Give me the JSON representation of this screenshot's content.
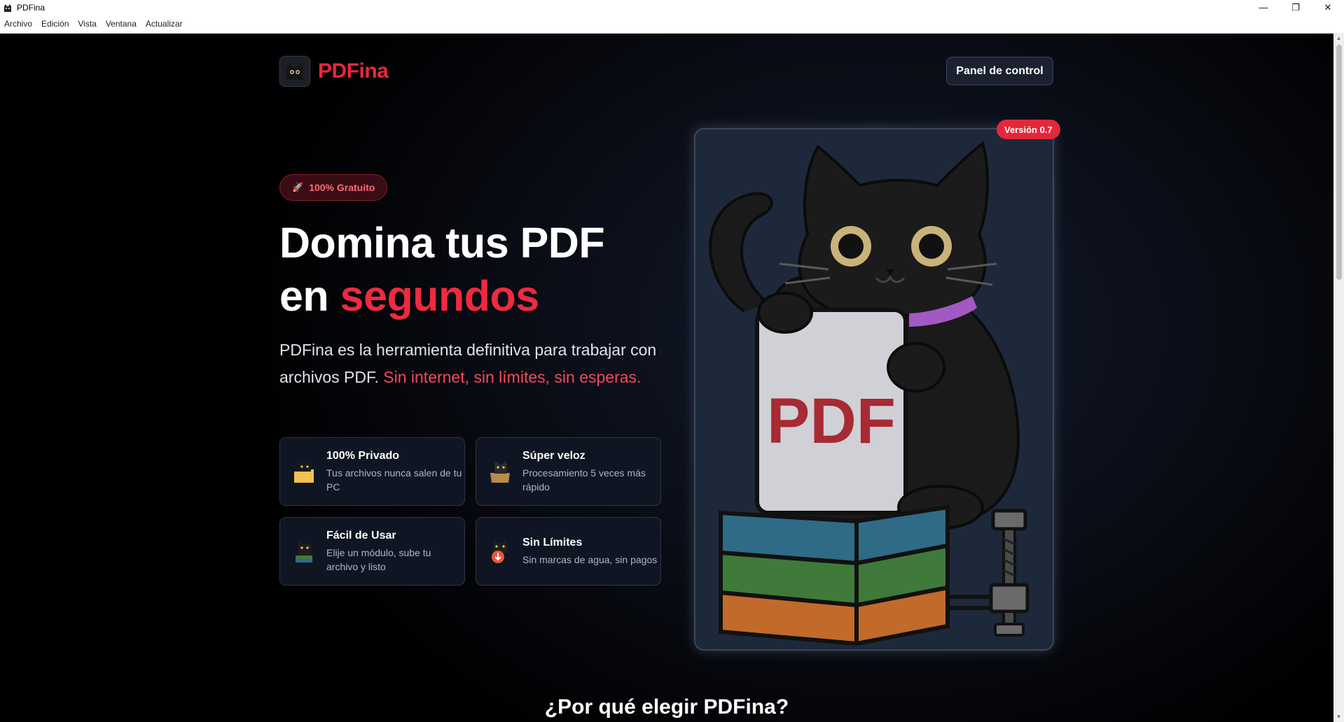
{
  "window": {
    "title": "PDFina",
    "controls": {
      "minimize": "—",
      "maximize": "❐",
      "close": "✕"
    }
  },
  "menu": [
    "Archivo",
    "Edición",
    "Vista",
    "Ventana",
    "Actualizar"
  ],
  "header": {
    "logo_text": "PDFina",
    "panel_button": "Panel de control"
  },
  "hero": {
    "badge": "100% Gratuito",
    "badge_icon": "rocket-icon",
    "title_line1": "Domina tus PDF",
    "title_line2_plain": "en ",
    "title_line2_accent": "segundos",
    "desc_plain": "PDFina es la herramienta definitiva para trabajar con archivos PDF. ",
    "desc_accent": "Sin internet, sin límites, sin esperas."
  },
  "features": [
    {
      "title": "100% Privado",
      "text": "Tus archivos nunca salen de tu PC",
      "icon": "cat-folder-icon"
    },
    {
      "title": "Súper veloz",
      "text": "Procesamiento 5 veces más rápido",
      "icon": "cat-box-icon"
    },
    {
      "title": "Fácil de Usar",
      "text": "Elije un módulo, sube tu archivo y listo",
      "icon": "cat-books-icon"
    },
    {
      "title": "Sin Límites",
      "text": "Sin marcas de agua, sin pagos",
      "icon": "cat-download-icon"
    }
  ],
  "illustration": {
    "version_badge": "Versión 0.7",
    "document_label": "PDF"
  },
  "section_heading": "¿Por qué elegir PDFina?",
  "colors": {
    "accent": "#e8283a",
    "background": "#000000",
    "card": "#0f1522",
    "illustration_bg": "#1e283b"
  }
}
